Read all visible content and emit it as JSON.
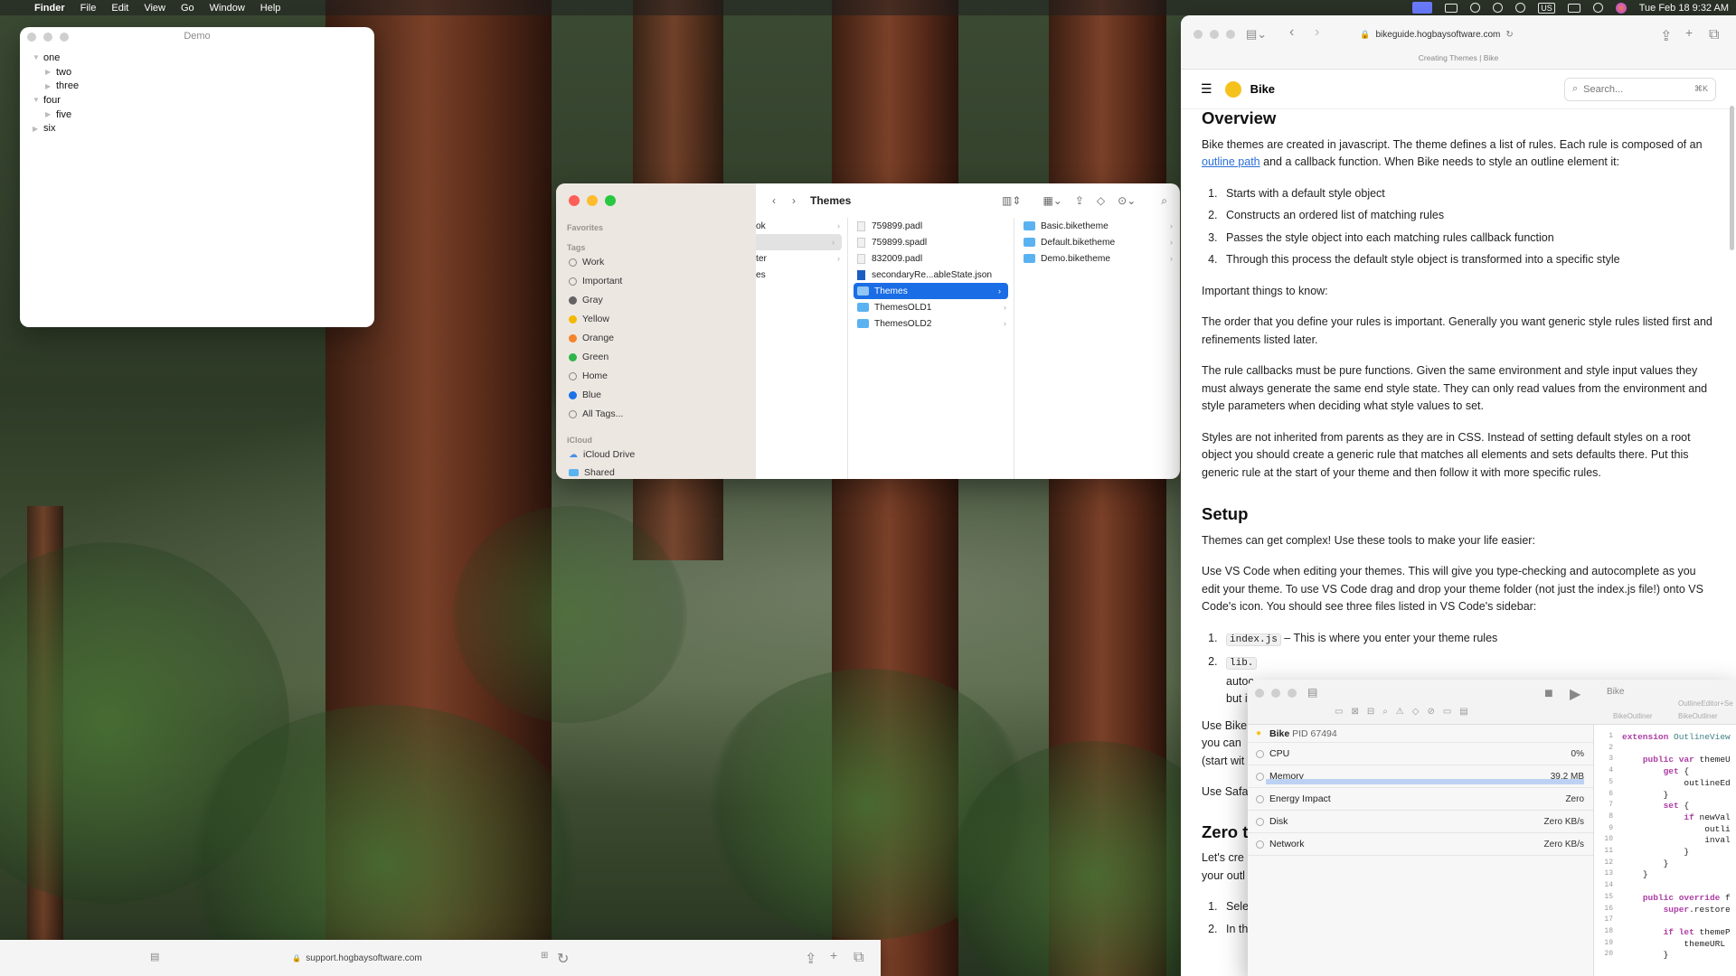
{
  "menubar": {
    "app": "Finder",
    "items": [
      "File",
      "Edit",
      "View",
      "Go",
      "Window",
      "Help"
    ],
    "input_source": "US",
    "clock": "Tue Feb 18  9:32 AM"
  },
  "demo_window": {
    "title": "Demo",
    "rows": [
      {
        "label": "one",
        "indent": 0,
        "expanded": true
      },
      {
        "label": "two",
        "indent": 1,
        "expanded": false
      },
      {
        "label": "three",
        "indent": 1,
        "expanded": false
      },
      {
        "label": "four",
        "indent": 0,
        "expanded": true
      },
      {
        "label": "five",
        "indent": 1,
        "expanded": false
      },
      {
        "label": "six",
        "indent": 0,
        "expanded": false
      }
    ]
  },
  "finder": {
    "title": "Themes",
    "sidebar": {
      "favorites_header": "Favorites",
      "tags_header": "Tags",
      "tags": [
        {
          "label": "Work",
          "color": "none"
        },
        {
          "label": "Important",
          "color": "none"
        },
        {
          "label": "Gray",
          "color": "#8e8e93"
        },
        {
          "label": "Yellow",
          "color": "#f5b800"
        },
        {
          "label": "Orange",
          "color": "#f5842a"
        },
        {
          "label": "Green",
          "color": "#2fb64a"
        },
        {
          "label": "Home",
          "color": "none"
        },
        {
          "label": "Blue",
          "color": "#1a73e8"
        },
        {
          "label": "All Tags...",
          "color": "none"
        }
      ],
      "icloud_header": "iCloud",
      "icloud_items": [
        "iCloud Drive",
        "Shared"
      ]
    },
    "column1": [
      "ok",
      "",
      "ter",
      "es"
    ],
    "column2": [
      {
        "label": "759899.padl",
        "kind": "file"
      },
      {
        "label": "759899.spadl",
        "kind": "file"
      },
      {
        "label": "832009.padl",
        "kind": "file"
      },
      {
        "label": "secondaryRe...ableState.json",
        "kind": "json"
      },
      {
        "label": "Themes",
        "kind": "folder",
        "selected": true
      },
      {
        "label": "ThemesOLD1",
        "kind": "folder"
      },
      {
        "label": "ThemesOLD2",
        "kind": "folder"
      }
    ],
    "column3": [
      {
        "label": "Basic.biketheme",
        "kind": "folder"
      },
      {
        "label": "Default.biketheme",
        "kind": "folder"
      },
      {
        "label": "Demo.biketheme",
        "kind": "folder"
      }
    ]
  },
  "safari": {
    "url": "bikeguide.hogbaysoftware.com",
    "tab_title": "Creating Themes | Bike",
    "site_name": "Bike",
    "search_placeholder": "Search...",
    "search_shortcut": "⌘K",
    "overview_heading": "Overview",
    "overview_p1_a": "Bike themes are created in javascript. The theme defines a list of rules. Each rule is composed of an ",
    "overview_p1_link": "outline path",
    "overview_p1_b": " and a callback function. When Bike needs to style an outline element it:",
    "steps": [
      "Starts with a default style object",
      "Constructs an ordered list of matching rules",
      "Passes the style object into each matching rules callback function",
      "Through this process the default style object is transformed into a specific style"
    ],
    "important": "Important things to know:",
    "p_order": "The order that you define your rules is important. Generally you want generic style rules listed first and  refinements listed later.",
    "p_callbacks": "The rule callbacks must be pure functions. Given the same environment and style input values they must always generate the same end style state. They can only read values from the environment and style parameters when deciding what style values to set.",
    "p_inherit": "Styles are not inherited from parents as they are in CSS. Instead of setting default styles on a root object you should create a generic rule that matches all elements and sets defaults there. Put this generic rule at the start of your theme and then follow it with more specific rules.",
    "setup_heading": "Setup",
    "setup_p1": "Themes can get complex! Use these tools to make your life easier:",
    "setup_p2": "Use VS Code when editing your themes. This will give you type-checking and autocomplete as you edit your theme. To use VS Code drag and drop your theme folder (not just the index.js file!) onto VS Code's icon. You should see three files listed in VS Code's sidebar:",
    "setup_item1_code": "index.js",
    "setup_item1_text": " – This is where you enter your theme rules",
    "setup_item2_code": "lib.",
    "setup_item2_rest": "autoc",
    "setup_item2_rest2": "but it",
    "use_bike_1": "Use Bike",
    "use_bike_2": "you can",
    "use_bike_3": "(start wit",
    "use_safari": "Use Safa",
    "zero_heading": "Zero t",
    "lets_1": "Let's cre",
    "lets_2": "your outl",
    "list_1": "Selec",
    "list_2": "In the"
  },
  "xcode": {
    "scheme": "Bike",
    "breadcrumb_1": "BikeOutliner",
    "breadcrumb_2": "BikeOutliner",
    "editor_tab": "OutlineEditor+Se",
    "process": "Bike",
    "pid": "PID 67494",
    "gauges": [
      {
        "label": "CPU",
        "value": "0%"
      },
      {
        "label": "Memory",
        "value": "39.2 MB"
      },
      {
        "label": "Energy Impact",
        "value": "Zero"
      },
      {
        "label": "Disk",
        "value": "Zero KB/s"
      },
      {
        "label": "Network",
        "value": "Zero KB/s"
      }
    ],
    "code_lines": [
      "extension OutlineView",
      "",
      "    public var themeU",
      "        get {",
      "            outlineEd",
      "        }",
      "        set {",
      "            if newVal",
      "                outli",
      "                inval",
      "            }",
      "        }",
      "    }",
      "",
      "    public override f",
      "        super.restore",
      "",
      "        if let themeP",
      "            themeURL",
      "        }"
    ]
  },
  "bottom_safari": {
    "url": "support.hogbaysoftware.com"
  }
}
